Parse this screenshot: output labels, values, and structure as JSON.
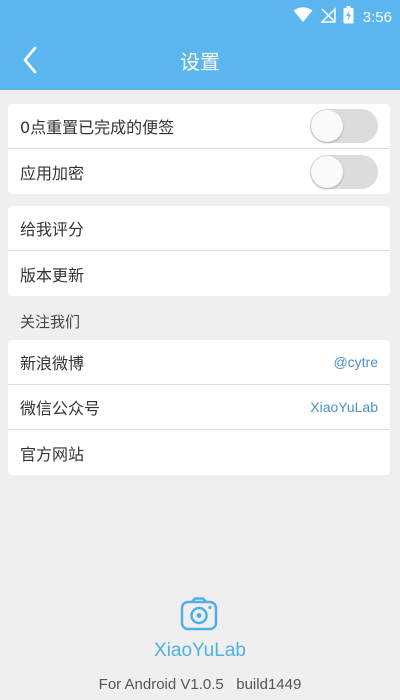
{
  "status_bar": {
    "time": "3:56",
    "icons": [
      "wifi-icon",
      "no-signal-icon",
      "battery-charging-icon"
    ]
  },
  "header": {
    "back_icon": "chevron-left-icon",
    "title": "设置"
  },
  "settings": {
    "toggles": [
      {
        "label": "0点重置已完成的便签",
        "enabled": false
      },
      {
        "label": "应用加密",
        "enabled": false
      }
    ],
    "app_items": [
      {
        "label": "给我评分"
      },
      {
        "label": "版本更新"
      }
    ],
    "follow_section_label": "关注我们",
    "follow_items": [
      {
        "label": "新浪微博",
        "value": "@cytre"
      },
      {
        "label": "微信公众号",
        "value": "XiaoYuLab"
      },
      {
        "label": "官方网站",
        "value": ""
      }
    ]
  },
  "footer": {
    "logo_icon": "camera-icon",
    "brand": "XiaoYuLab",
    "version": "For Android V1.0.5   build1449"
  },
  "colors": {
    "accent": "#5bb5ee",
    "link": "#4a90c8",
    "background": "#efefef"
  }
}
